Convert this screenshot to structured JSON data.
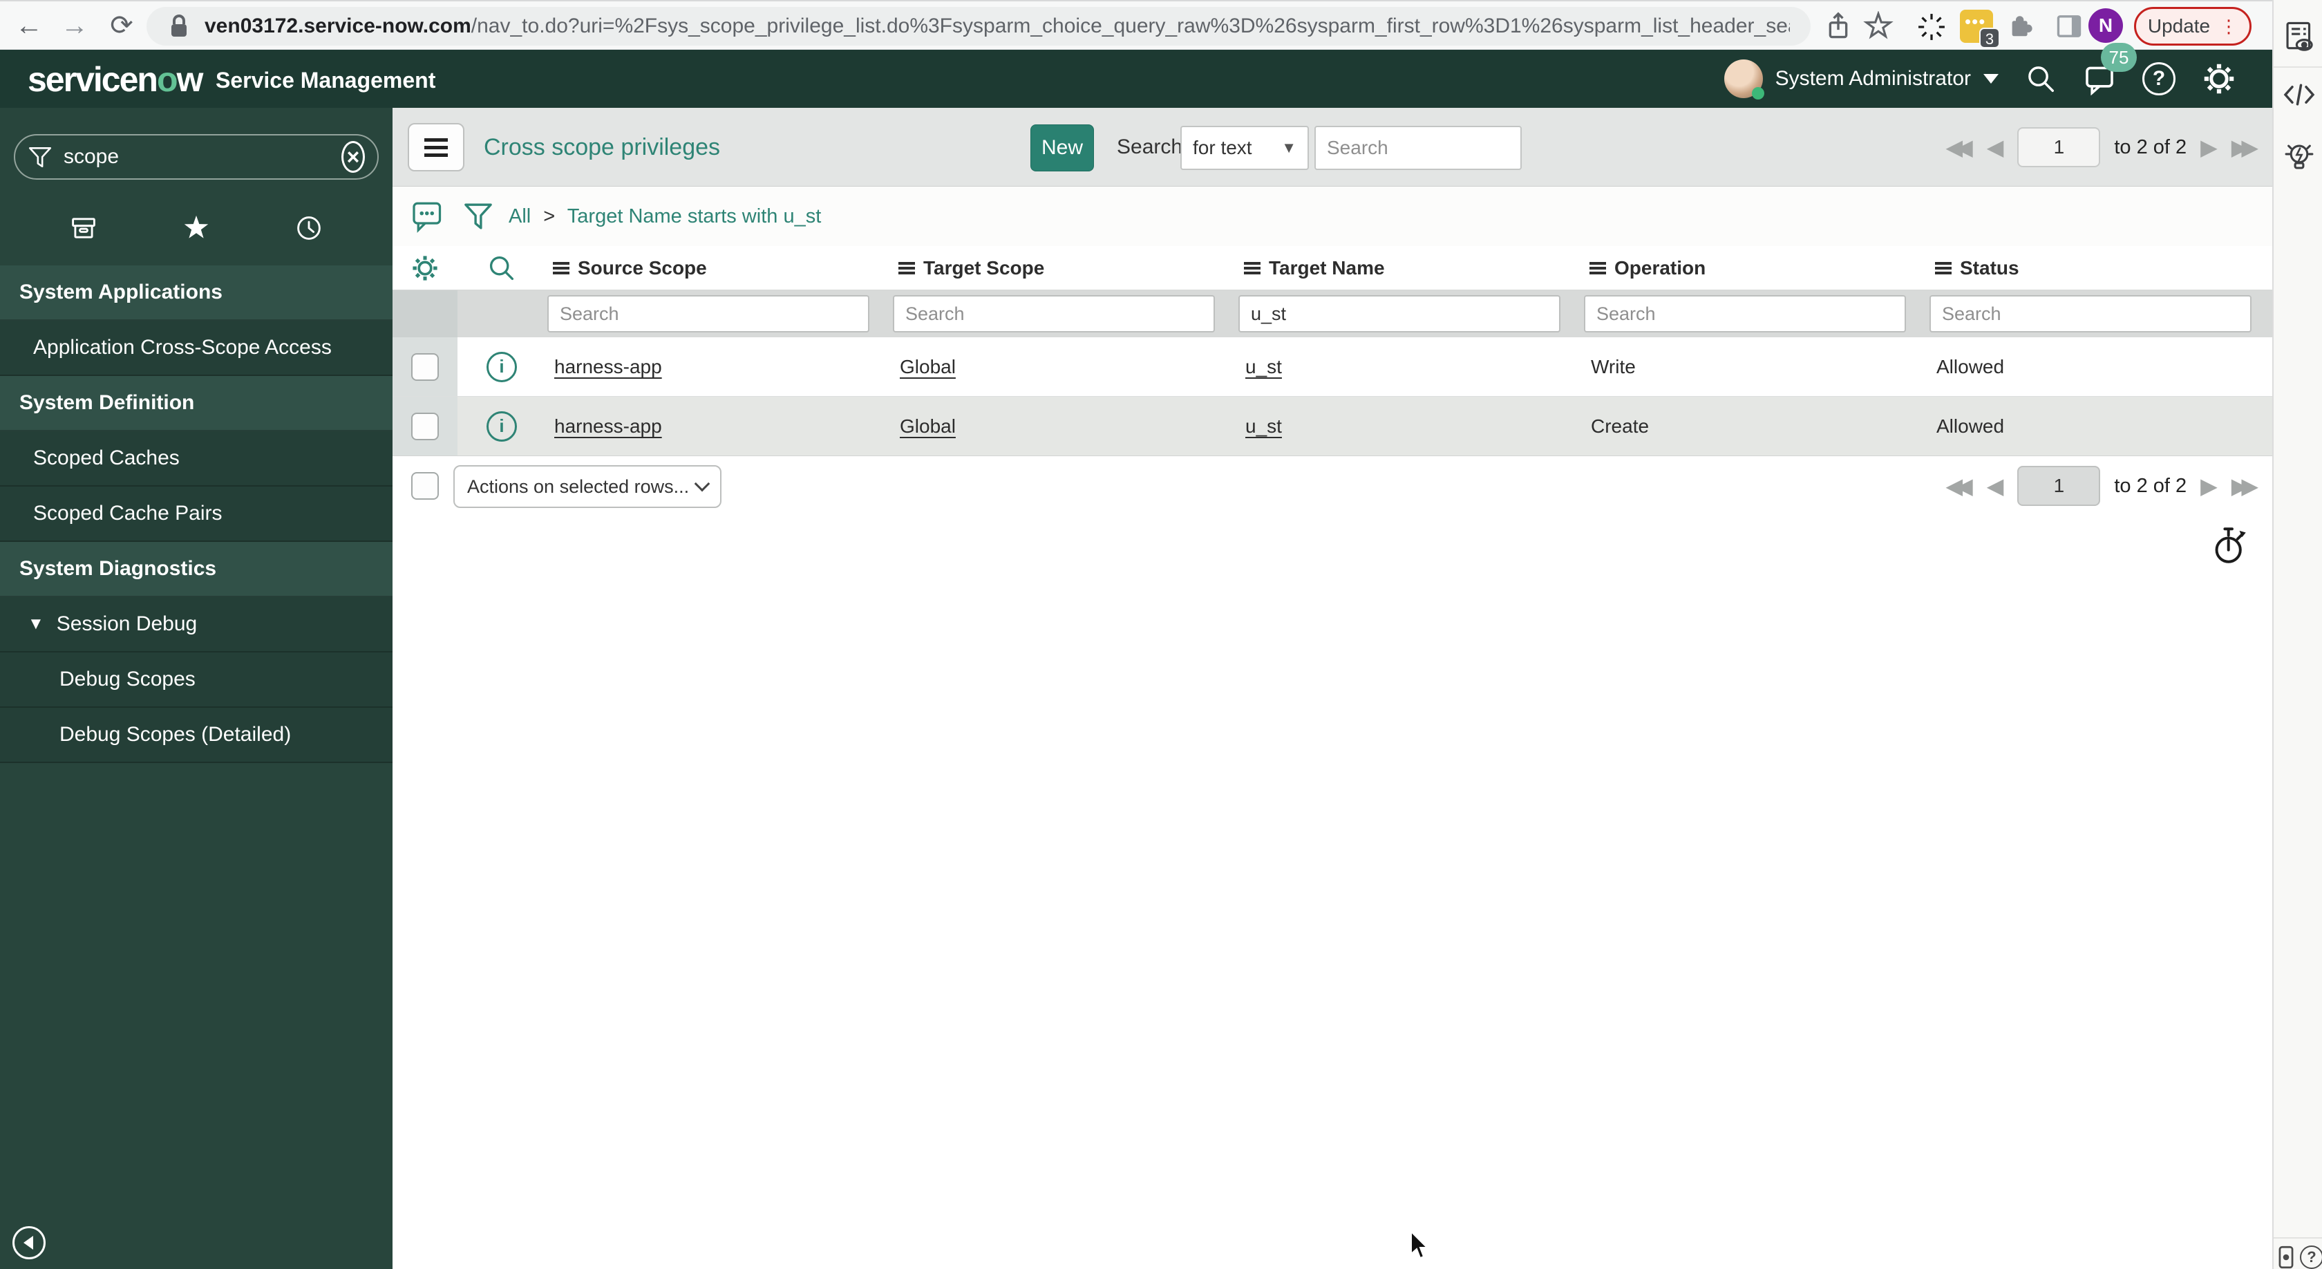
{
  "browser": {
    "url_host": "ven03172.service-now.com",
    "url_path": "/nav_to.do?uri=%2Fsys_scope_privilege_list.do%3Fsysparm_choice_query_raw%3D%26sysparm_first_row%3D1%26sysparm_list_header_searc...",
    "extension_badge": "3",
    "avatar_initial": "N",
    "update_label": "Update"
  },
  "sn": {
    "logo_pre": "servicen",
    "logo_o": "o",
    "logo_post": "w",
    "product": "Service Management",
    "user": "System Administrator",
    "notif_count": "75"
  },
  "sidebar": {
    "search_value": "scope",
    "items": [
      {
        "label": "System Applications",
        "type": "section"
      },
      {
        "label": "Application Cross-Scope Access",
        "type": "module"
      },
      {
        "label": "System Definition",
        "type": "section"
      },
      {
        "label": "Scoped Caches",
        "type": "module"
      },
      {
        "label": "Scoped Cache Pairs",
        "type": "module"
      },
      {
        "label": "System Diagnostics",
        "type": "section"
      },
      {
        "label": "Session Debug",
        "type": "module-expanded"
      },
      {
        "label": "Debug Scopes",
        "type": "submodule"
      },
      {
        "label": "Debug Scopes (Detailed)",
        "type": "submodule"
      }
    ]
  },
  "list": {
    "title": "Cross scope privileges",
    "new_label": "New",
    "search_label": "Search",
    "search_mode": "for text",
    "search_placeholder": "Search"
  },
  "crumb": {
    "root": "All",
    "sep": ">",
    "query": "Target Name starts with u_st"
  },
  "table": {
    "columns": [
      "Source Scope",
      "Target Scope",
      "Target Name",
      "Operation",
      "Status"
    ],
    "filter_placeholder": "Search",
    "filters": {
      "target_name": "u_st"
    },
    "rows": [
      {
        "source_scope": "harness-app",
        "target_scope": "Global",
        "target_name": "u_st",
        "operation": "Write",
        "status": "Allowed"
      },
      {
        "source_scope": "harness-app",
        "target_scope": "Global",
        "target_name": "u_st",
        "operation": "Create",
        "status": "Allowed"
      }
    ]
  },
  "actions_label": "Actions on selected rows...",
  "pager": {
    "page": "1",
    "range": "to 2 of 2"
  },
  "colors": {
    "accent": "#2e8475",
    "header_bg": "#1d3a32",
    "sidebar_bg": "#28453c",
    "sidebar_section_bg": "#315148",
    "sidebar_module_bg": "#243f37",
    "badge": "#69b89d",
    "new_button_bg": "#2a8171",
    "bar_bg": "#e3e5e4",
    "filter_bg": "#d8dad9",
    "row_alt_bg": "#e5e7e4",
    "update_red": "#c5221f"
  }
}
